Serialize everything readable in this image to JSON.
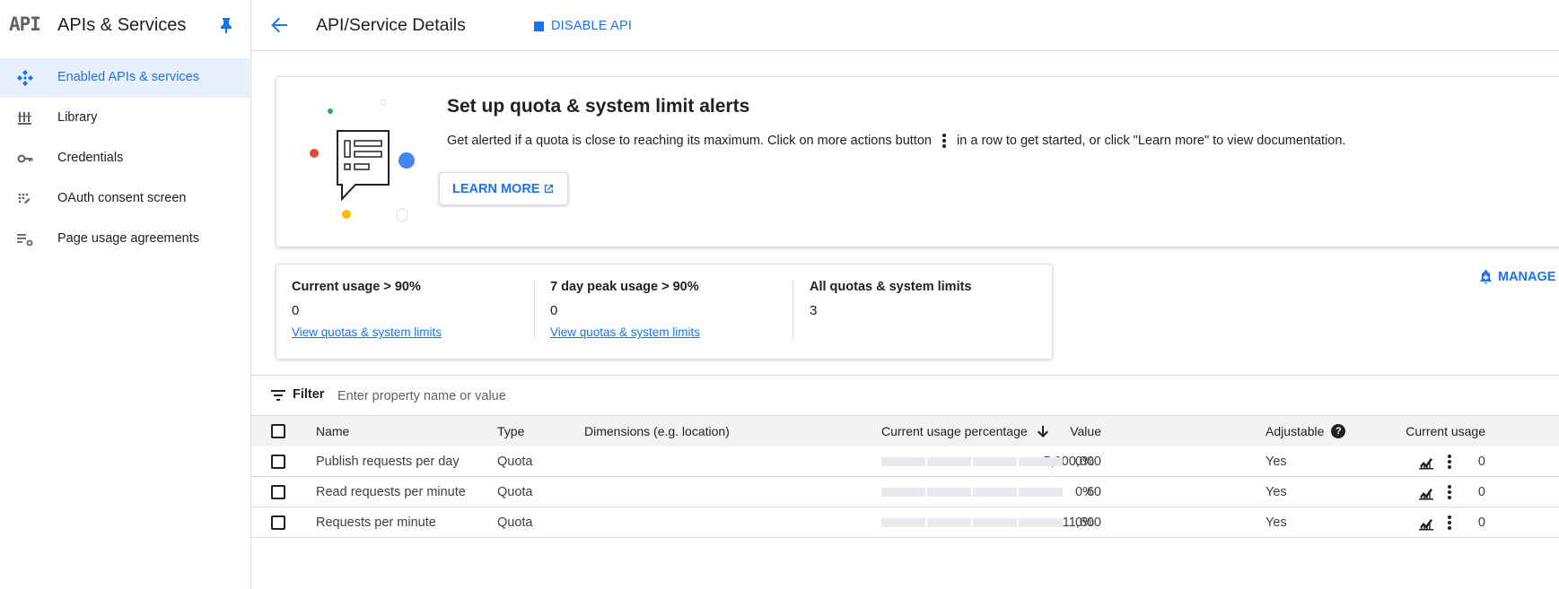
{
  "sidebar": {
    "logo": "API",
    "title": "APIs & Services",
    "items": [
      {
        "label": "Enabled APIs & services",
        "icon": "enabled-apis-icon"
      },
      {
        "label": "Library",
        "icon": "library-icon"
      },
      {
        "label": "Credentials",
        "icon": "key-icon"
      },
      {
        "label": "OAuth consent screen",
        "icon": "oauth-icon"
      },
      {
        "label": "Page usage agreements",
        "icon": "settings-list-icon"
      }
    ]
  },
  "header": {
    "title": "API/Service Details",
    "disable_label": "DISABLE API"
  },
  "alert_card": {
    "title": "Set up quota & system limit alerts",
    "desc_before": "Get alerted if a quota is close to reaching its maximum. Click on more actions button",
    "desc_after": "in a row to get started, or click \"Learn more\" to view documentation.",
    "learn_more": "LEARN MORE"
  },
  "stats": [
    {
      "heading": "Current usage > 90%",
      "value": "0",
      "link": "View quotas & system limits"
    },
    {
      "heading": "7 day peak usage > 90%",
      "value": "0",
      "link": "View quotas & system limits"
    },
    {
      "heading": "All quotas & system limits",
      "value": "3"
    }
  ],
  "manage_label": "MANAGE A",
  "filter": {
    "label": "Filter",
    "placeholder": "Enter property name or value"
  },
  "table": {
    "headers": {
      "name": "Name",
      "type": "Type",
      "dimensions": "Dimensions (e.g. location)",
      "value": "Value",
      "usage_pct": "Current usage percentage",
      "usage": "Current usage",
      "adjustable": "Adjustable"
    },
    "rows": [
      {
        "name": "Publish requests per day",
        "type": "Quota",
        "value": "5,000,000",
        "pct": "0%",
        "usage": "0",
        "adjustable": "Yes"
      },
      {
        "name": "Read requests per minute",
        "type": "Quota",
        "value": "60",
        "pct": "0%",
        "usage": "0",
        "adjustable": "Yes"
      },
      {
        "name": "Requests per minute",
        "type": "Quota",
        "value": "11,600",
        "pct": "0%",
        "usage": "0",
        "adjustable": "Yes"
      }
    ]
  },
  "colors": {
    "accent": "#1a73e8",
    "active_bg": "#e8f0fe",
    "border": "#dadce0"
  }
}
